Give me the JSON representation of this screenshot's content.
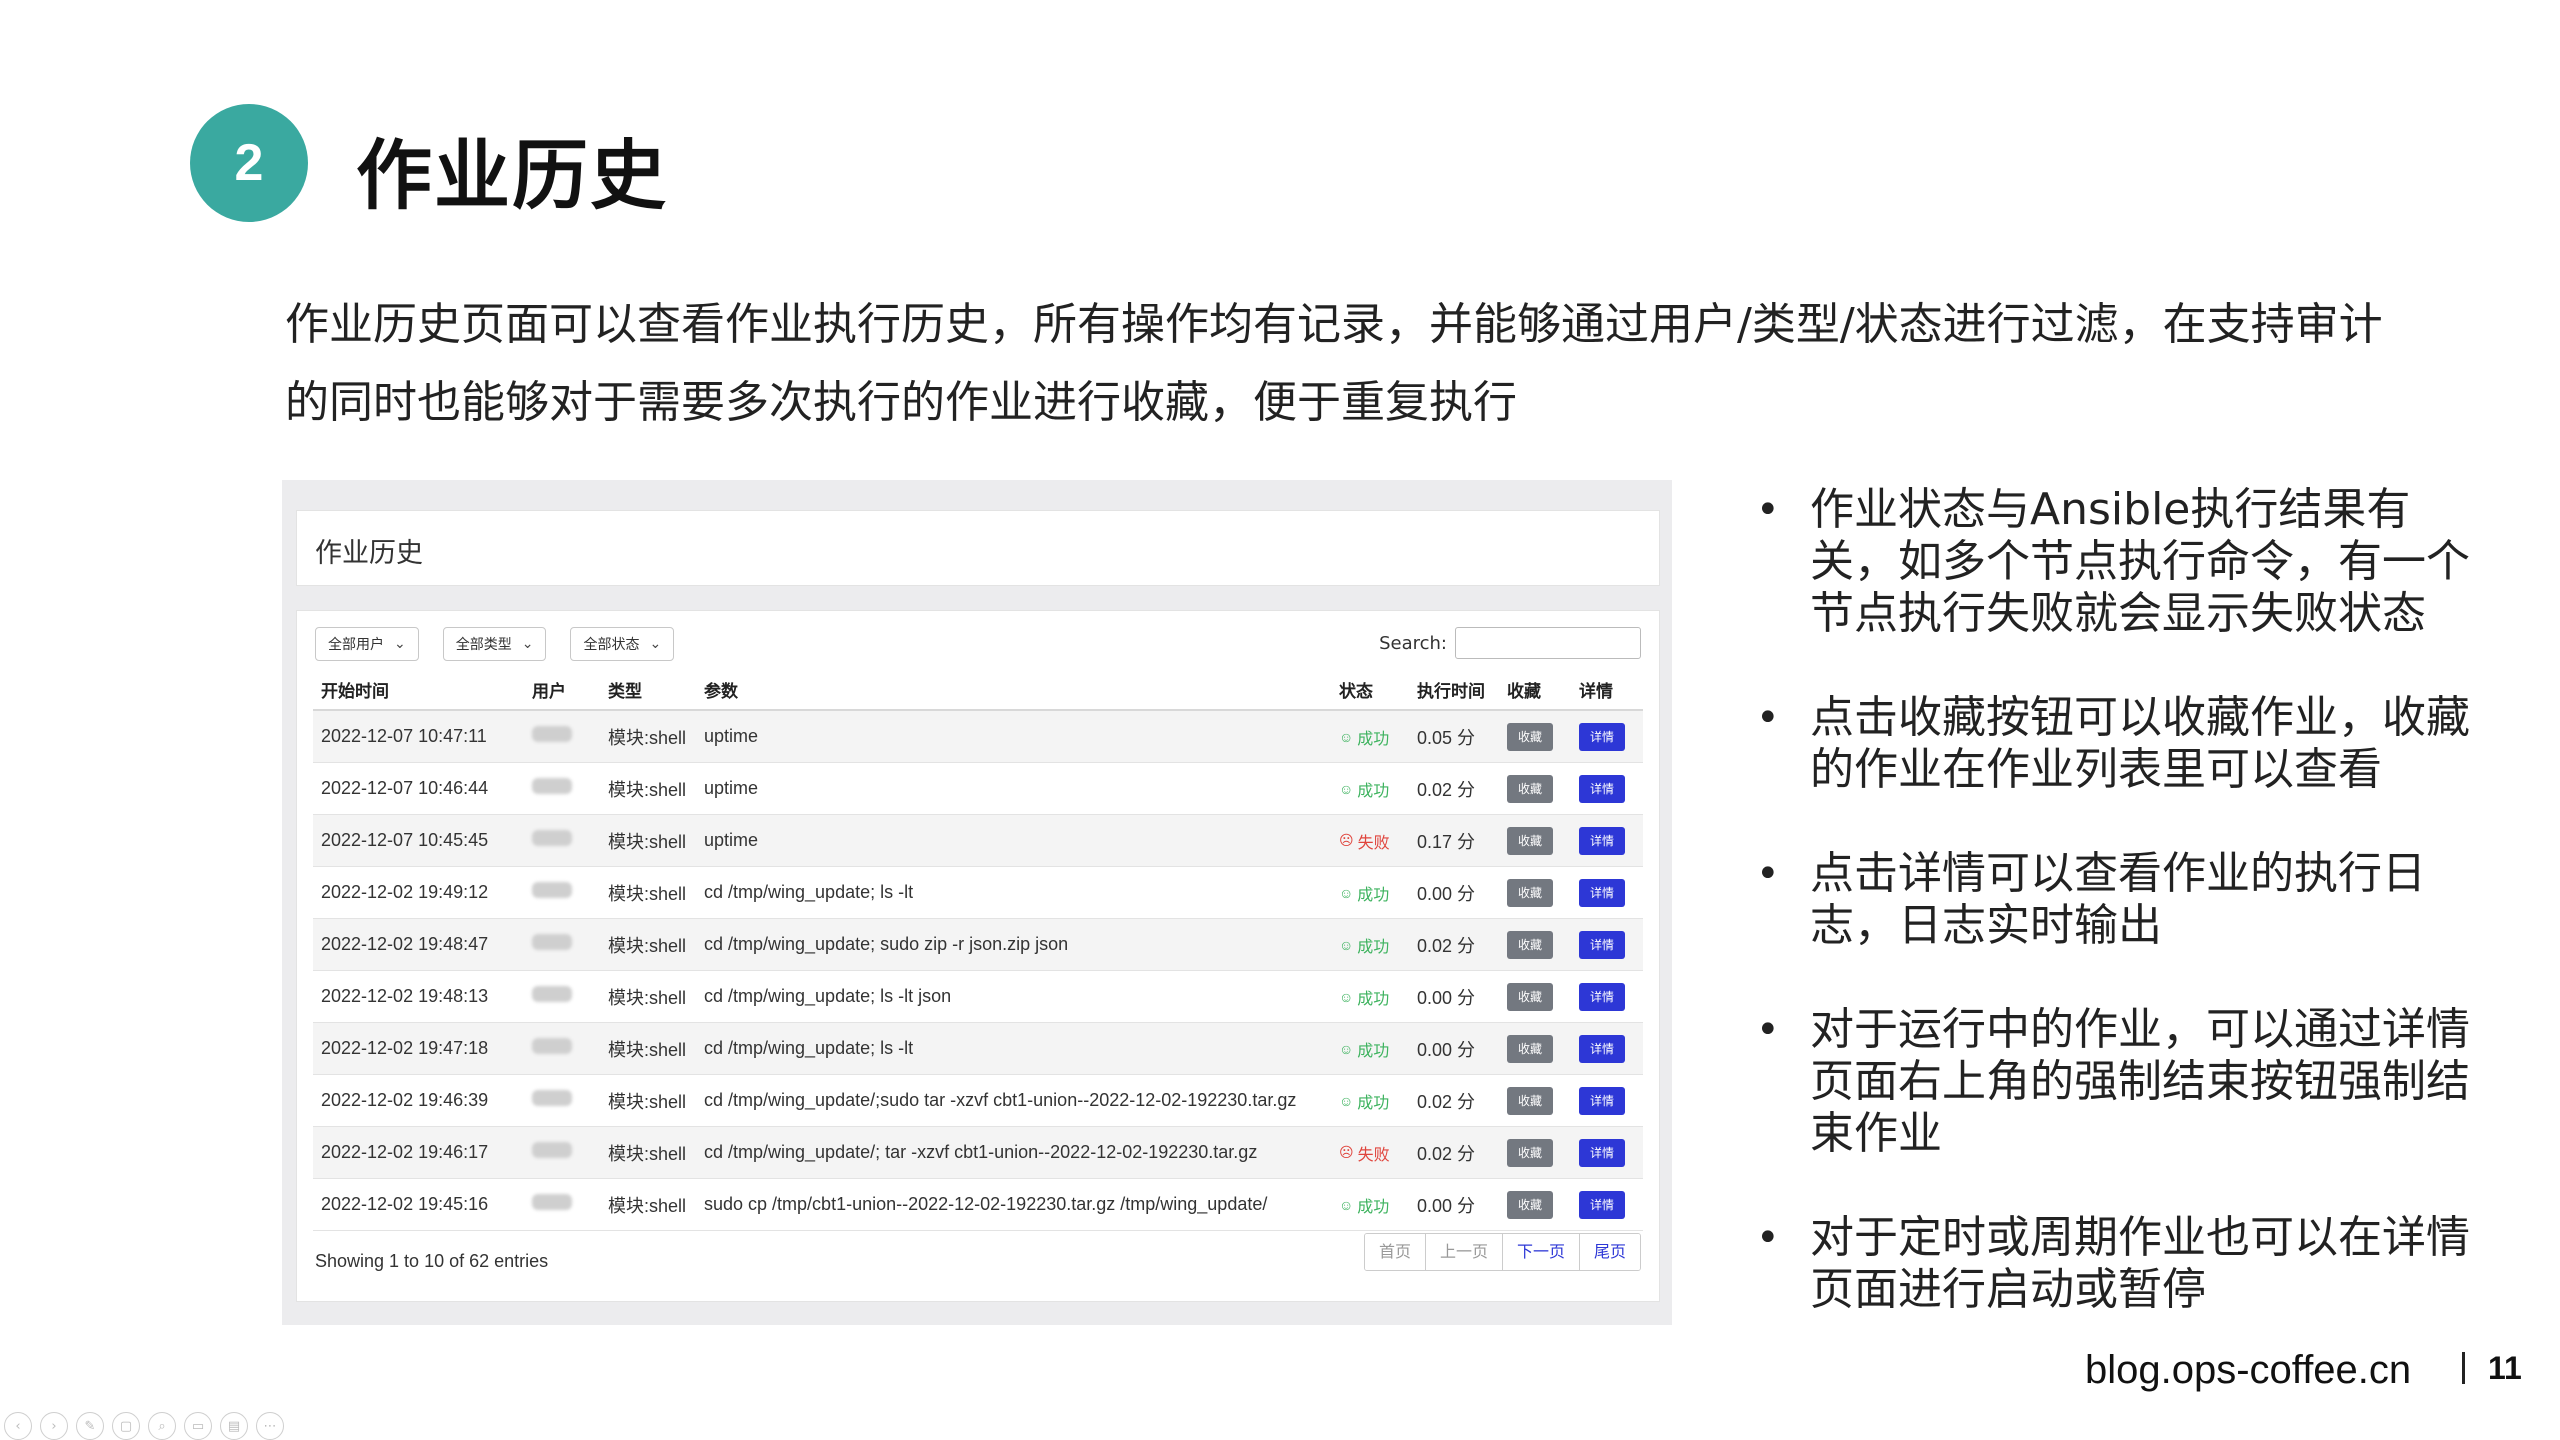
{
  "slide": {
    "number": "2",
    "title": "作业历史",
    "intro": "作业历史页面可以查看作业执行历史，所有操作均有记录，并能够通过用户/类型/状态进行过滤，在支持审计的同时也能够对于需要多次执行的作业进行收藏，便于重复执行",
    "bullets": [
      "作业状态与Ansible执行结果有关，如多个节点执行命令，有一个节点执行失败就会显示失败状态",
      "点击收藏按钮可以收藏作业，收藏的作业在作业列表里可以查看",
      "点击详情可以查看作业的执行日志，日志实时输出",
      "对于运行中的作业，可以通过详情页面右上角的强制结束按钮强制结束作业",
      "对于定时或周期作业也可以在详情页面进行启动或暂停"
    ],
    "footer_site": "blog.ops-coffee.cn",
    "page_number": "11"
  },
  "screenshot": {
    "header_title": "作业历史",
    "filters": [
      "全部用户",
      "全部类型",
      "全部状态"
    ],
    "search_label": "Search:",
    "columns": [
      "开始时间",
      "用户",
      "类型",
      "参数",
      "状态",
      "执行时间",
      "收藏",
      "详情"
    ],
    "rows": [
      {
        "time": "2022-12-07 10:47:11",
        "type": "模块:shell",
        "args": "uptime",
        "status": "成功",
        "ok": true,
        "duration": "0.05 分"
      },
      {
        "time": "2022-12-07 10:46:44",
        "type": "模块:shell",
        "args": "uptime",
        "status": "成功",
        "ok": true,
        "duration": "0.02 分"
      },
      {
        "time": "2022-12-07 10:45:45",
        "type": "模块:shell",
        "args": "uptime",
        "status": "失败",
        "ok": false,
        "duration": "0.17 分"
      },
      {
        "time": "2022-12-02 19:49:12",
        "type": "模块:shell",
        "args": "cd /tmp/wing_update; ls -lt",
        "status": "成功",
        "ok": true,
        "duration": "0.00 分"
      },
      {
        "time": "2022-12-02 19:48:47",
        "type": "模块:shell",
        "args": "cd /tmp/wing_update; sudo zip -r json.zip json",
        "status": "成功",
        "ok": true,
        "duration": "0.02 分"
      },
      {
        "time": "2022-12-02 19:48:13",
        "type": "模块:shell",
        "args": "cd /tmp/wing_update; ls -lt json",
        "status": "成功",
        "ok": true,
        "duration": "0.00 分"
      },
      {
        "time": "2022-12-02 19:47:18",
        "type": "模块:shell",
        "args": "cd /tmp/wing_update; ls -lt",
        "status": "成功",
        "ok": true,
        "duration": "0.00 分"
      },
      {
        "time": "2022-12-02 19:46:39",
        "type": "模块:shell",
        "args": "cd /tmp/wing_update/;sudo tar -xzvf cbt1-union--2022-12-02-192230.tar.gz",
        "status": "成功",
        "ok": true,
        "duration": "0.02 分"
      },
      {
        "time": "2022-12-02 19:46:17",
        "type": "模块:shell",
        "args": "cd /tmp/wing_update/; tar -xzvf cbt1-union--2022-12-02-192230.tar.gz",
        "status": "失败",
        "ok": false,
        "duration": "0.02 分"
      },
      {
        "time": "2022-12-02 19:45:16",
        "type": "模块:shell",
        "args": "sudo cp /tmp/cbt1-union--2022-12-02-192230.tar.gz /tmp/wing_update/",
        "status": "成功",
        "ok": true,
        "duration": "0.00 分"
      }
    ],
    "fav_label": "收藏",
    "detail_label": "详情",
    "entries_text": "Showing 1 to 10 of 62 entries",
    "pager": [
      "首页",
      "上一页",
      "下一页",
      "尾页"
    ]
  },
  "colors": {
    "badge": "#3aa9a0",
    "success": "#3eb35f",
    "fail": "#e0443c",
    "detail_button": "#2d37d6",
    "fav_button": "#737880"
  }
}
